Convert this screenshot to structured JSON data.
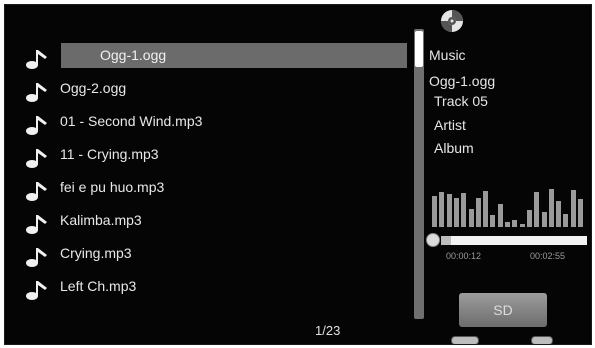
{
  "tracks": [
    {
      "label": "Ogg-1.ogg"
    },
    {
      "label": "Ogg-2.ogg"
    },
    {
      "label": "01 - Second Wind.mp3"
    },
    {
      "label": "11 - Crying.mp3"
    },
    {
      "label": "fei e pu huo.mp3"
    },
    {
      "label": "Kalimba.mp3"
    },
    {
      "label": "Crying.mp3"
    },
    {
      "label": "Left Ch.mp3"
    }
  ],
  "selected_index": 0,
  "page_indicator": "1/23",
  "info": {
    "category": "Music",
    "filename": "Ogg-1.ogg",
    "track": "Track 05",
    "artist": "Artist",
    "album": "Album"
  },
  "playback": {
    "elapsed": "00:00:12",
    "total": "00:02:55",
    "progress": 0.07
  },
  "spectrum_levels": [
    0.78,
    0.88,
    0.82,
    0.72,
    0.85,
    0.45,
    0.72,
    0.9,
    0.3,
    0.58,
    0.12,
    0.18,
    0.08,
    0.42,
    0.88,
    0.38,
    0.95,
    0.65,
    0.32,
    0.92,
    0.7
  ],
  "storage_badge": "SD",
  "colors": {
    "screen_bg": "#050505",
    "selection": "#6b6b6b",
    "scrollbar": "#6f6f6f",
    "spectrum": "#9a9a9a"
  }
}
